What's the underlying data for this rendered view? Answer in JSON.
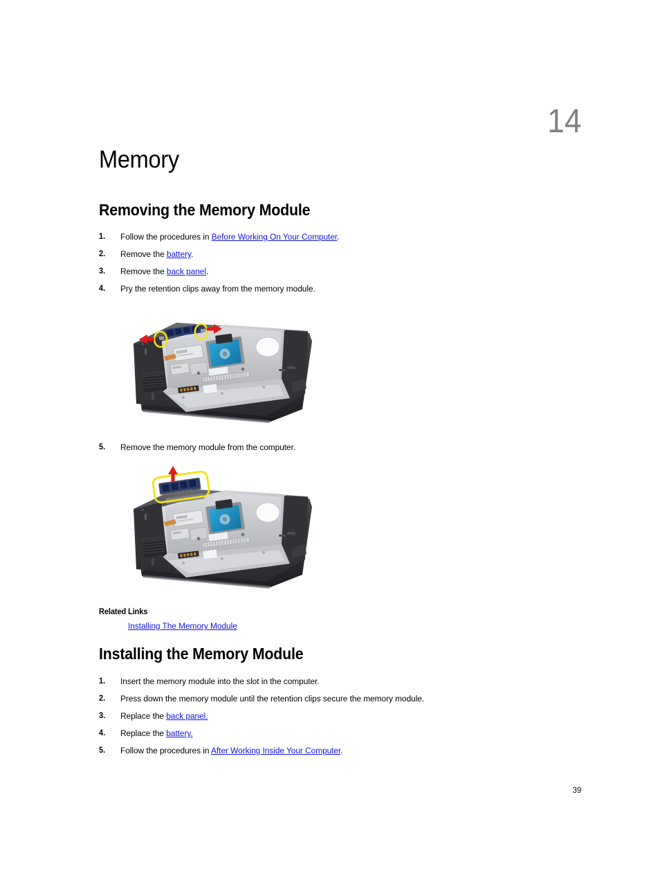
{
  "document": {
    "chapter_number": "14",
    "chapter_title": "Memory",
    "page_number": "39"
  },
  "sections": {
    "removing": {
      "heading": "Removing the Memory Module",
      "steps_before_figure1": [
        {
          "num": "1.",
          "pre": "Follow the procedures in ",
          "link": "Before Working On Your Computer",
          "post": "."
        },
        {
          "num": "2.",
          "pre": "Remove the ",
          "link": "battery",
          "post": "."
        },
        {
          "num": "3.",
          "pre": "Remove the ",
          "link": "back panel",
          "post": "."
        },
        {
          "num": "4.",
          "pre": "Pry the retention clips away from the memory module.",
          "link": "",
          "post": ""
        }
      ],
      "steps_after_figure1": [
        {
          "num": "5.",
          "pre": "Remove the memory module from the computer.",
          "link": "",
          "post": ""
        }
      ]
    },
    "related_links": {
      "heading": "Related Links",
      "links": [
        "Installing The Memory Module"
      ]
    },
    "installing": {
      "heading": "Installing the Memory Module",
      "steps": [
        {
          "num": "1.",
          "pre": "Insert the memory module into the slot in the computer.",
          "link": "",
          "post": ""
        },
        {
          "num": "2.",
          "pre": "Press down the memory module until the retention clips secure the memory module.",
          "link": "",
          "post": ""
        },
        {
          "num": "3.",
          "pre": "Replace the ",
          "link": "back panel.",
          "post": ""
        },
        {
          "num": "4.",
          "pre": "Replace the ",
          "link": "battery.",
          "post": ""
        },
        {
          "num": "5.",
          "pre": "Follow the procedures in ",
          "link": "After Working Inside Your Computer",
          "post": "."
        }
      ]
    }
  },
  "figures": {
    "figure1": {
      "caption_step": "4",
      "description": "Bottom view of laptop with back panel removed showing memory module retention clips being pried outward",
      "callout_type": "two-yellow-circles-with-red-arrows",
      "callout_count": 2
    },
    "figure2": {
      "caption_step": "5",
      "description": "Bottom view of laptop with memory module being lifted out of its slot",
      "callout_type": "yellow-rounded-rectangle-with-red-up-arrow",
      "callout_count": 1
    }
  },
  "colors": {
    "link": "#1414e6",
    "chapter_number": "#808080",
    "callout_yellow": "#f5e215",
    "callout_red": "#e01b1b",
    "laptop_body_dark": "#2f3033",
    "laptop_chassis_silver": "#c9cace",
    "hdd_blue": "#1d8fc4"
  }
}
